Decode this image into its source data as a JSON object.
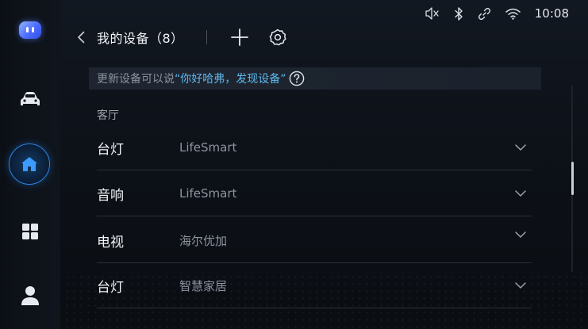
{
  "status_bar": {
    "time": "10:08",
    "icons": [
      "mute-icon",
      "bluetooth-icon",
      "link-icon",
      "wifi-icon"
    ]
  },
  "sidebar": {
    "items": [
      {
        "icon": "assistant-robot-icon",
        "active": false
      },
      {
        "icon": "car-icon",
        "active": false
      },
      {
        "icon": "home-icon",
        "active": true
      },
      {
        "icon": "apps-grid-icon",
        "active": false
      },
      {
        "icon": "user-icon",
        "active": false
      }
    ]
  },
  "header": {
    "title": "我的设备（8）",
    "add_icon": "plus-icon",
    "settings_icon": "gear-icon"
  },
  "hint": {
    "prefix": "更新设备可以说",
    "phrase": "“你好哈弗，发现设备”"
  },
  "section": {
    "label": "客厅"
  },
  "devices": [
    {
      "name": "台灯",
      "brand": "LifeSmart"
    },
    {
      "name": "音响",
      "brand": "LifeSmart"
    },
    {
      "name": "电视",
      "brand": "海尔优加"
    },
    {
      "name": "台灯",
      "brand": "智慧家居"
    }
  ],
  "colors": {
    "accent": "#2a86e8",
    "hint_phrase": "#5fb8ee",
    "text_primary": "#f0f3f7",
    "text_secondary": "#8c949f"
  }
}
